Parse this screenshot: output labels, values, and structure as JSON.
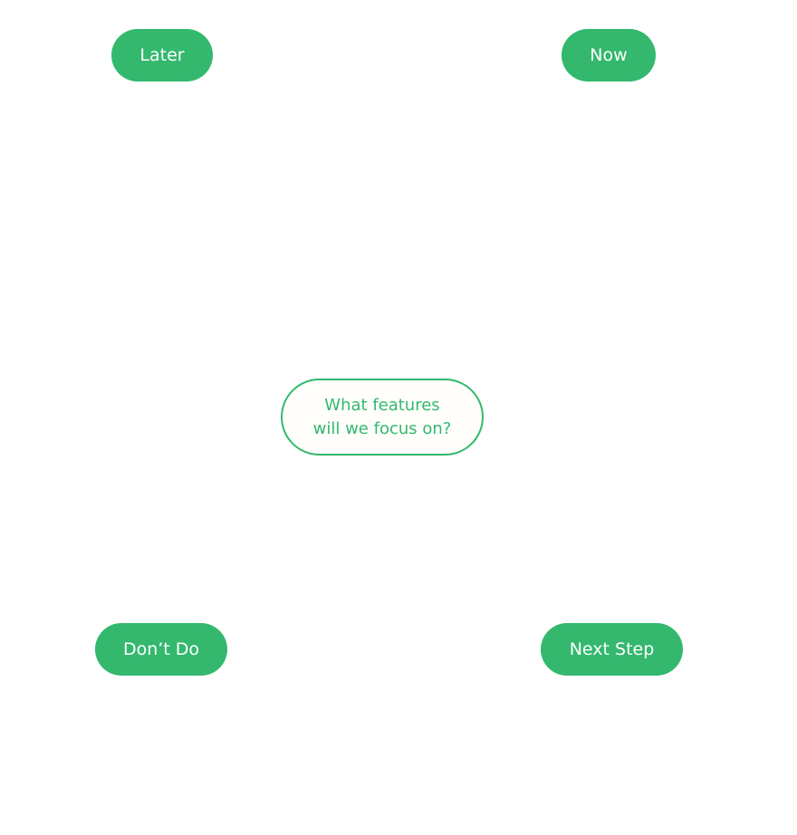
{
  "quadrants": {
    "top_left": "Later",
    "top_right": "Now",
    "bottom_left": "Don’t Do",
    "bottom_right": "Next Step"
  },
  "center": {
    "line1": "What features",
    "line2": "will we focus on?"
  },
  "colors": {
    "accent": "#33b86e",
    "label_text": "#ffffff",
    "center_fill": "#fffefb",
    "background": "#ffffff"
  }
}
